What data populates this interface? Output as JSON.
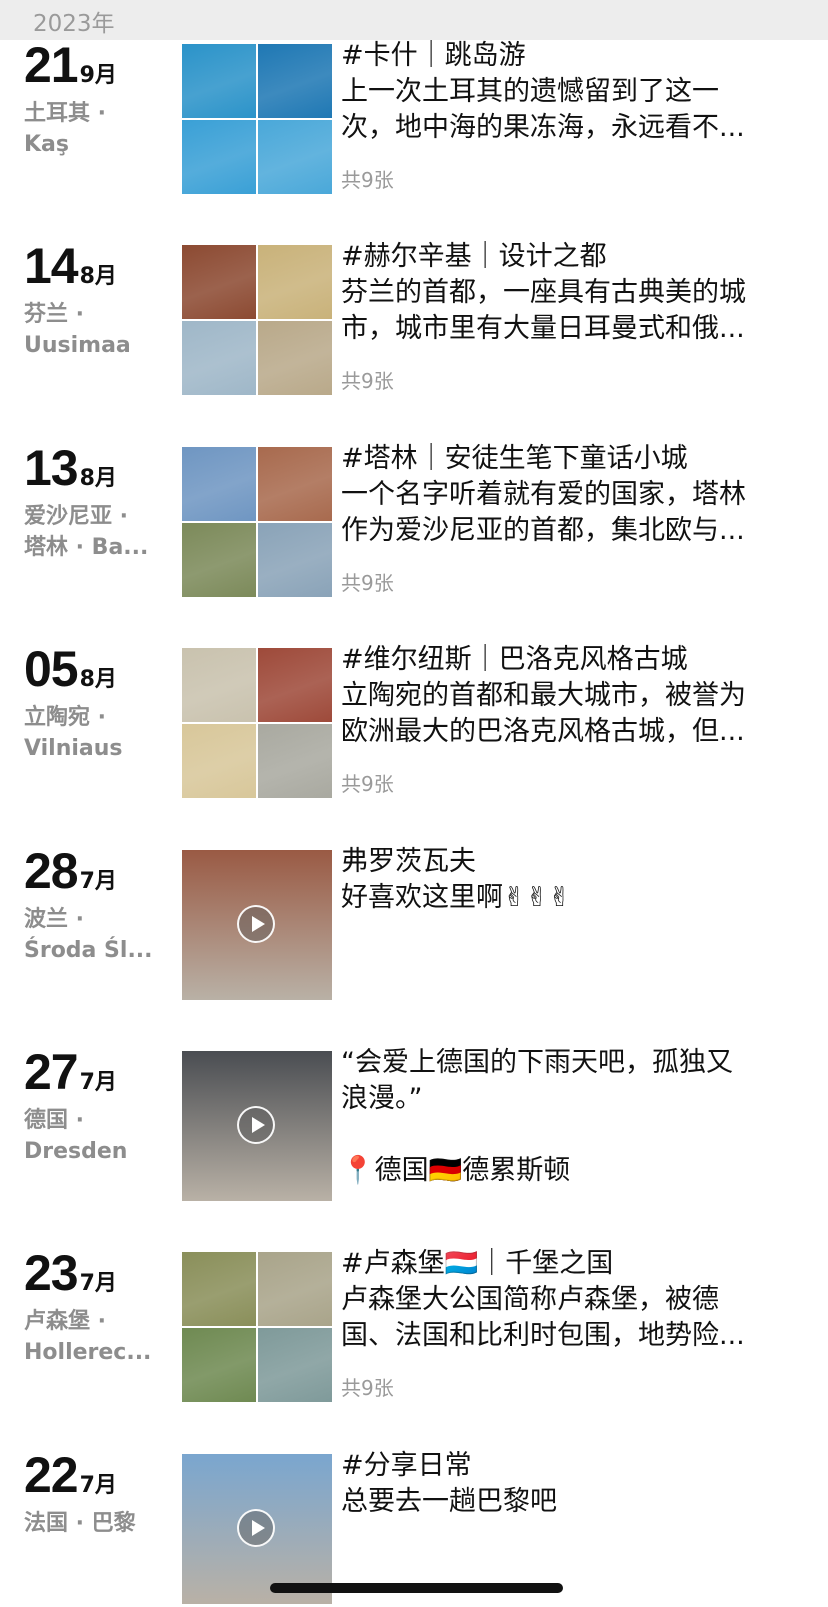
{
  "year_header": "2023年",
  "posts": [
    {
      "day": "21",
      "month": "9月",
      "location": [
        "土耳其 ·",
        "Kaş"
      ],
      "title": "#卡什｜跳岛游",
      "lines": [
        "上一次土耳其的遗憾留到了这一",
        "次，地中海的果冻海，永远看不..."
      ],
      "count": "共9张",
      "media": "grid",
      "colors": [
        "#2b93c9",
        "#1f78b4",
        "#3aa0d6",
        "#4aa8d9"
      ]
    },
    {
      "day": "14",
      "month": "8月",
      "location": [
        "芬兰 ·",
        "Uusimaa"
      ],
      "title": "#赫尔辛基｜设计之都",
      "lines": [
        "芬兰的首都，一座具有古典美的城",
        "市，城市里有大量日耳曼式和俄..."
      ],
      "count": "共9张",
      "media": "grid",
      "colors": [
        "#8c4a32",
        "#c9b27a",
        "#9fb7c8",
        "#b9a98a"
      ]
    },
    {
      "day": "13",
      "month": "8月",
      "location": [
        "爱沙尼亚 ·",
        "塔林 · Ba..."
      ],
      "title": "#塔林｜安徒生笔下童话小城",
      "lines": [
        "一个名字听着就有爱的国家，塔林",
        "作为爱沙尼亚的首都，集北欧与..."
      ],
      "count": "共9张",
      "media": "grid",
      "colors": [
        "#6f96c2",
        "#a86a4e",
        "#7c8a5a",
        "#8aa3b8"
      ]
    },
    {
      "day": "05",
      "month": "8月",
      "location": [
        "立陶宛 ·",
        "Vilniaus"
      ],
      "title": "#维尔纽斯｜巴洛克风格古城",
      "lines": [
        "立陶宛的首都和最大城市，被誉为",
        "欧洲最大的巴洛克风格古城，但..."
      ],
      "count": "共9张",
      "media": "grid",
      "colors": [
        "#c9c2ae",
        "#9e4a3a",
        "#d8c79a",
        "#a9a9a0"
      ]
    },
    {
      "day": "28",
      "month": "7月",
      "location": [
        "波兰 ·",
        "Środa Śl..."
      ],
      "title": "弗罗茨瓦夫",
      "lines": [
        "好喜欢这里啊✌✌✌"
      ],
      "count": "",
      "media": "video",
      "colors": [
        "#9a5a44"
      ]
    },
    {
      "day": "27",
      "month": "7月",
      "location": [
        "德国 ·",
        "Dresden"
      ],
      "title": "“会爱上德国的下雨天吧，孤独又",
      "lines": [
        "浪漫。”",
        "",
        "📍德国🇩🇪德累斯顿"
      ],
      "count": "",
      "media": "video",
      "colors": [
        "#4a4d52"
      ]
    },
    {
      "day": "23",
      "month": "7月",
      "location": [
        "卢森堡 ·",
        "Hollerec..."
      ],
      "title": "#卢森堡🇱🇺｜千堡之国",
      "lines": [
        "卢森堡大公国简称卢森堡，被德",
        "国、法国和比利时包围，地势险..."
      ],
      "count": "共9张",
      "media": "grid",
      "colors": [
        "#8a8f5a",
        "#a9a48a",
        "#6f8a52",
        "#7f9a9a"
      ]
    },
    {
      "day": "22",
      "month": "7月",
      "location": [
        "法国 · 巴黎"
      ],
      "title": "#分享日常",
      "lines": [
        "总要去一趟巴黎吧"
      ],
      "count": "",
      "media": "video",
      "colors": [
        "#7aa6cf"
      ]
    }
  ]
}
